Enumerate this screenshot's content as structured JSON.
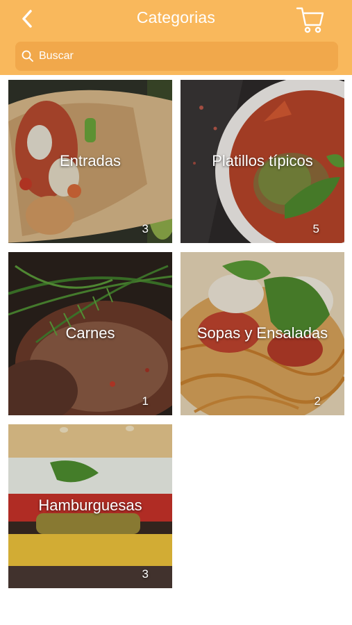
{
  "header": {
    "title": "Categorias",
    "back_icon": "chevron-left-icon",
    "cart_icon": "shopping-cart-icon",
    "background_color": "#f9b85c"
  },
  "search": {
    "placeholder": "Buscar",
    "value": "",
    "icon": "search-icon"
  },
  "categories": [
    {
      "name": "Entradas",
      "count": "3"
    },
    {
      "name": "Platillos típicos",
      "count": "5"
    },
    {
      "name": "Carnes",
      "count": "1"
    },
    {
      "name": "Sopas y Ensaladas",
      "count": "2"
    },
    {
      "name": "Hamburguesas",
      "count": "3"
    }
  ]
}
